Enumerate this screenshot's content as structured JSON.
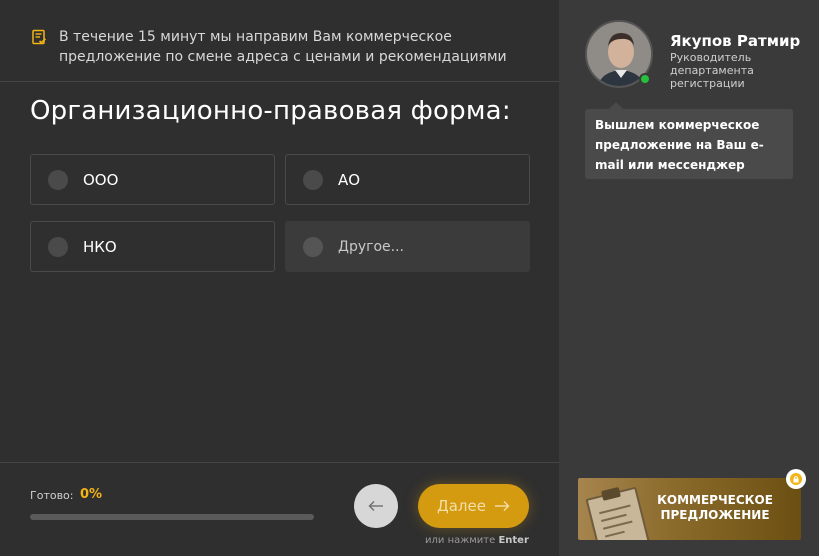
{
  "notice": {
    "icon": "document-check-icon",
    "text": "В течение 15 минут мы направим Вам коммерческое предложение по смене адреса с ценами и рекомендациями"
  },
  "question": {
    "title": "Организационно-правовая форма:",
    "options": [
      {
        "label": "ООО",
        "selected": false
      },
      {
        "label": "АО",
        "selected": false
      },
      {
        "label": "НКО",
        "selected": false
      }
    ],
    "other": {
      "placeholder": "Другое...",
      "value": ""
    }
  },
  "footer": {
    "progress_label": "Готово:",
    "progress_value": "0%",
    "progress_percent": 0,
    "back_icon": "arrow-left-icon",
    "next_label": "Далее",
    "next_icon": "arrow-right-icon",
    "hint_prefix": "или нажмите",
    "hint_key": "Enter"
  },
  "manager": {
    "name": "Якупов Ратмир",
    "role": "Руководитель департамента регистрации",
    "status": "online",
    "message": "Вышлем коммерческое предложение на Ваш e-mail или мессенджер"
  },
  "offer": {
    "label": "КОММЕРЧЕСКОЕ ПРЕДЛОЖЕНИЕ",
    "badge_icon": "lock-icon"
  },
  "colors": {
    "accent": "#f2b416",
    "button": "#d49a10",
    "online": "#27c03a",
    "background": "#2f2f2f",
    "sidebar": "#3a3a3a"
  }
}
